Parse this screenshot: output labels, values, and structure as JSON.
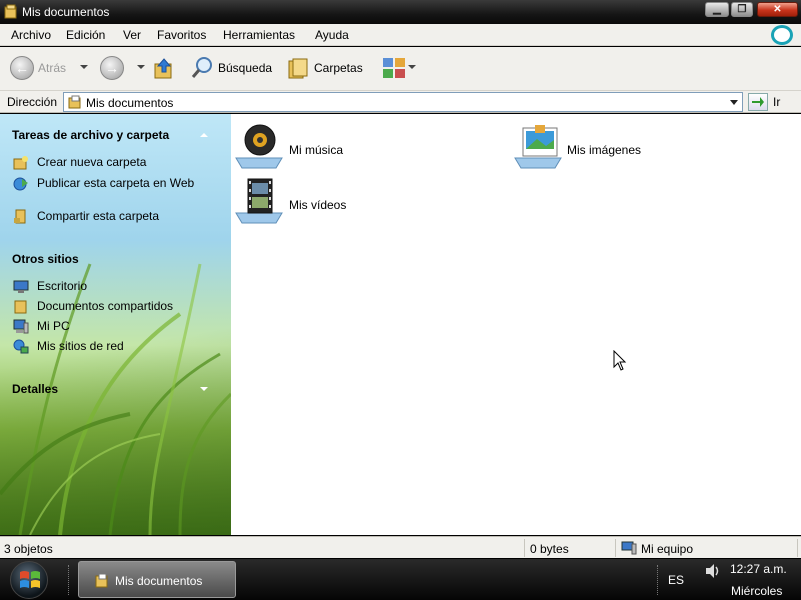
{
  "window": {
    "title": "Mis documentos",
    "min_glyph": "▁",
    "max_glyph": "❐",
    "close_glyph": "✕"
  },
  "menu": {
    "items": [
      "Archivo",
      "Edición",
      "Ver",
      "Favoritos",
      "Herramientas",
      "Ayuda"
    ]
  },
  "toolbar": {
    "back_label": "Atrás",
    "search_label": "Búsqueda",
    "folders_label": "Carpetas"
  },
  "address": {
    "label": "Dirección",
    "value": "Mis documentos",
    "go_label": "Ir"
  },
  "sidebar": {
    "tasks_title": "Tareas de archivo y carpeta",
    "tasks": [
      {
        "label": "Crear nueva carpeta",
        "icon": "new-folder-icon"
      },
      {
        "label": "Publicar esta carpeta en Web",
        "icon": "publish-web-icon"
      },
      {
        "label": "Compartir esta carpeta",
        "icon": "share-folder-icon"
      }
    ],
    "places_title": "Otros sitios",
    "places": [
      {
        "label": "Escritorio",
        "icon": "desktop-icon"
      },
      {
        "label": "Documentos compartidos",
        "icon": "shared-docs-icon"
      },
      {
        "label": "Mi PC",
        "icon": "my-computer-icon"
      },
      {
        "label": "Mis sitios de red",
        "icon": "network-places-icon"
      }
    ],
    "details_title": "Detalles"
  },
  "main": {
    "items": [
      {
        "label": "Mi música",
        "icon": "music-folder-icon"
      },
      {
        "label": "Mis imágenes",
        "icon": "pictures-folder-icon"
      },
      {
        "label": "Mis vídeos",
        "icon": "videos-folder-icon"
      }
    ]
  },
  "status": {
    "objects": "3 objetos",
    "size": "0 bytes",
    "zone": "Mi equipo"
  },
  "taskbar": {
    "task_label": "Mis documentos",
    "lang": "ES",
    "time": "12:27 a.m.",
    "day": "Miércoles"
  },
  "colors": {
    "titlebar": "#151515",
    "close": "#c8341c",
    "panel_text": "#000000"
  }
}
